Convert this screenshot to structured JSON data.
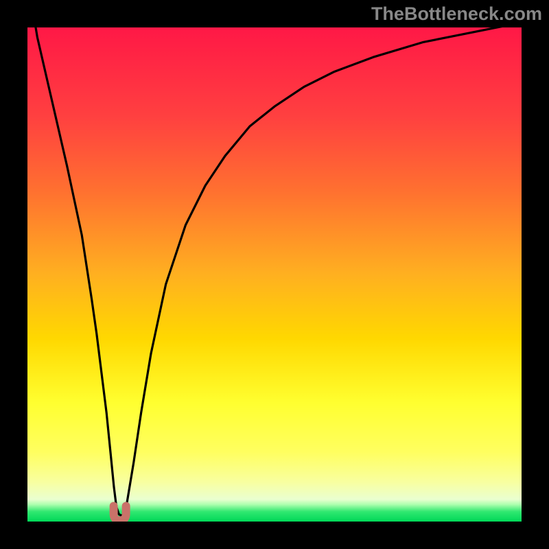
{
  "chart_data": {
    "type": "line",
    "title": "",
    "xlabel": "",
    "ylabel": "",
    "xlim": [
      0,
      100
    ],
    "ylim": [
      0,
      100
    ],
    "x": [
      0,
      2,
      5,
      8,
      11,
      13,
      14,
      15,
      16,
      16.8,
      17.5,
      18,
      18.5,
      19,
      19.5,
      20,
      20.5,
      21.5,
      23,
      25,
      28,
      32,
      36,
      40,
      45,
      50,
      56,
      62,
      70,
      80,
      90,
      100
    ],
    "values": [
      110,
      98,
      85,
      72,
      58,
      45,
      38,
      30,
      22,
      14,
      7,
      3,
      1.5,
      1.2,
      1.5,
      3,
      6,
      12,
      22,
      34,
      48,
      60,
      68,
      74,
      80,
      84,
      88,
      91,
      94,
      97,
      99,
      101
    ],
    "annotations": [
      {
        "text": "TheBottleneck.com",
        "position": "top-right"
      }
    ],
    "background": "rainbow-gradient-with-green-band",
    "marker": {
      "x": 18.7,
      "style": "u-shape",
      "color": "#c97269"
    }
  },
  "watermark": "TheBottleneck.com",
  "layout": {
    "size": 800,
    "inner_margin": 40,
    "inner_size": 720
  },
  "colors": {
    "frame": "#000000",
    "gradient_top": "#ff1846",
    "gradient_mid1": "#ff7030",
    "gradient_mid2": "#ffd200",
    "gradient_mid3": "#ffff44",
    "gradient_mid4": "#f4ffb0",
    "green_band": "#00e060",
    "curve": "#000000",
    "marker": "#c97269"
  }
}
